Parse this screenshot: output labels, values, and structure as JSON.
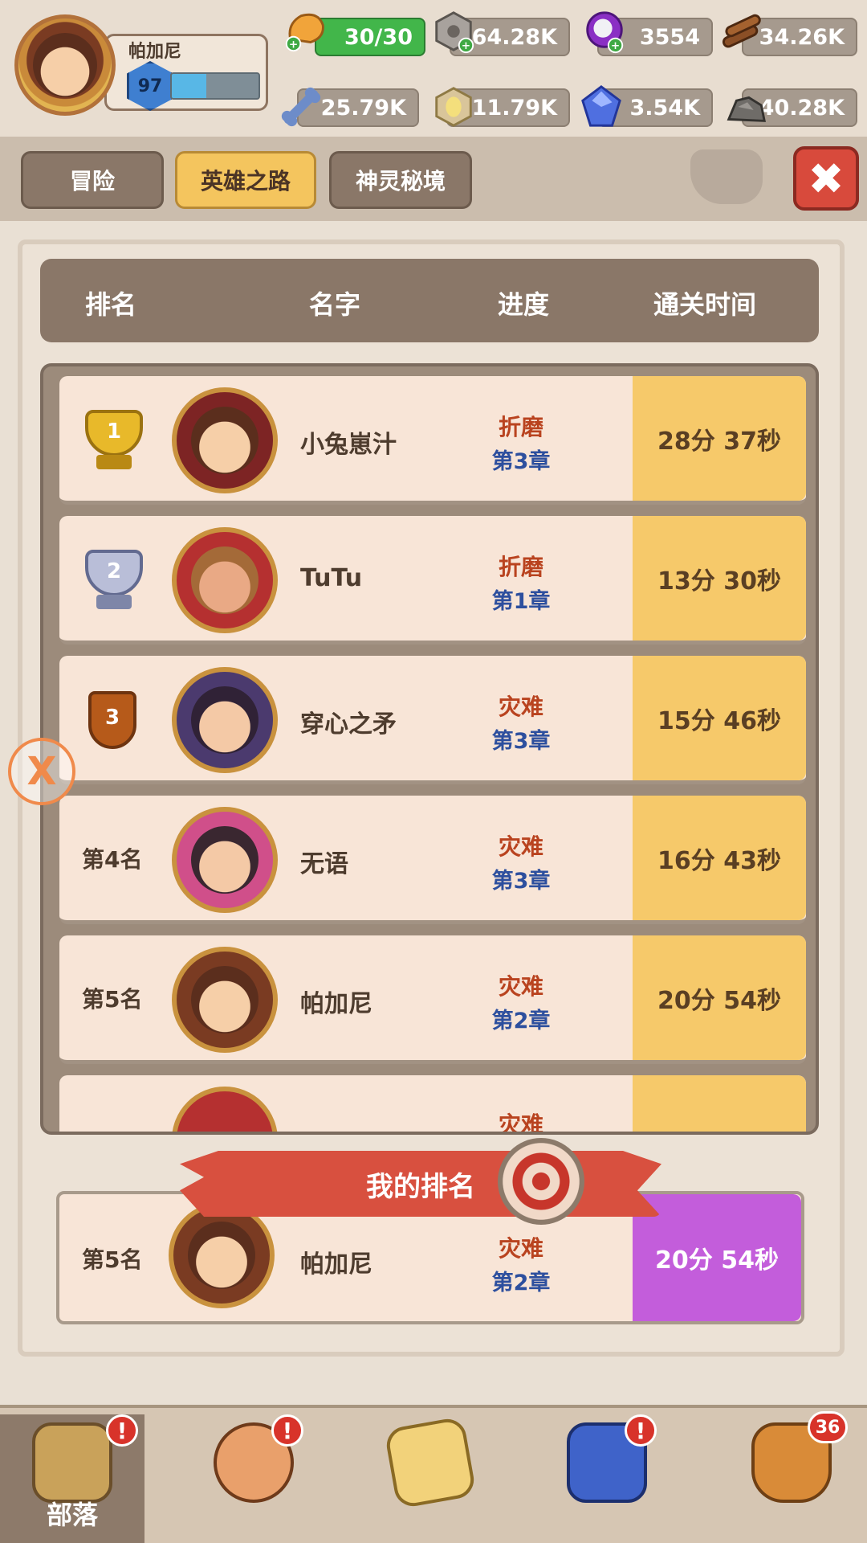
{
  "player": {
    "name": "帕加尼",
    "level": "97",
    "xp_fraction": 0.4
  },
  "resources": {
    "energy": "30/30",
    "stone_nut": "64.28K",
    "orb": "3554",
    "wood": "34.26K",
    "bone": "25.79K",
    "egg": "11.79K",
    "crystal": "3.54K",
    "ore": "40.28K"
  },
  "tabs": [
    {
      "label": "冒险"
    },
    {
      "label": "英雄之路"
    },
    {
      "label": "神灵秘境"
    }
  ],
  "active_tab": "英雄之路",
  "close_icon": "close-icon",
  "table": {
    "headers": [
      "排名",
      "名字",
      "进度",
      "通关时间"
    ],
    "rows": [
      {
        "rank_label": "1",
        "rank_type": "gold-trophy",
        "name": "小兔崽汁",
        "difficulty": "折磨",
        "chapter": "第3章",
        "time": "28分 37秒"
      },
      {
        "rank_label": "2",
        "rank_type": "silver-trophy",
        "name": "TuTu",
        "difficulty": "折磨",
        "chapter": "第1章",
        "time": "13分 30秒"
      },
      {
        "rank_label": "3",
        "rank_type": "bronze-shield",
        "name": "穿心之矛",
        "difficulty": "灾难",
        "chapter": "第3章",
        "time": "15分 46秒"
      },
      {
        "rank_label": "第4名",
        "rank_type": "text",
        "name": "无语",
        "difficulty": "灾难",
        "chapter": "第3章",
        "time": "16分 43秒"
      },
      {
        "rank_label": "第5名",
        "rank_type": "text",
        "name": "帕加尼",
        "difficulty": "灾难",
        "chapter": "第2章",
        "time": "20分 54秒"
      },
      {
        "rank_label": "",
        "rank_type": "text",
        "name": "",
        "difficulty": "灾难",
        "chapter": "",
        "time": ""
      }
    ]
  },
  "my_rank": {
    "banner": "我的排名",
    "rank_label": "第5名",
    "name": "帕加尼",
    "difficulty": "灾难",
    "chapter": "第2章",
    "time": "20分 54秒"
  },
  "bottom_nav": [
    {
      "label": "部落",
      "icon": "tribe-hut-icon",
      "alert": "!"
    },
    {
      "label": "",
      "icon": "hero-icon",
      "alert": "!"
    },
    {
      "label": "",
      "icon": "map-icon",
      "alert": ""
    },
    {
      "label": "",
      "icon": "pet-wolf-icon",
      "alert": "!"
    },
    {
      "label": "",
      "icon": "bag-icon",
      "alert": "36"
    }
  ],
  "colors": {
    "accent_tab": "#f4c55e",
    "time_cell": "#f6c96a",
    "my_time_cell": "#c35ddb",
    "difficulty_text": "#b9431f",
    "chapter_text": "#2d4f9e",
    "close_button": "#d84a3c"
  }
}
